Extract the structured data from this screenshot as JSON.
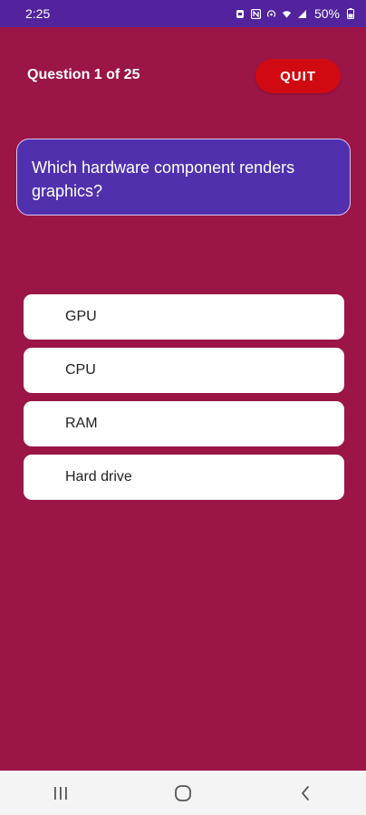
{
  "status_bar": {
    "time": "2:25",
    "battery": "50%",
    "icons": [
      "notification-icon",
      "nfc-icon",
      "hotspot-icon",
      "wifi-icon",
      "signal-icon",
      "battery-icon"
    ]
  },
  "quiz": {
    "counter": "Question 1 of 25",
    "quit_label": "QUIT",
    "question": "Which hardware component renders graphics?",
    "options": [
      "GPU",
      "CPU",
      "RAM",
      "Hard drive"
    ]
  },
  "nav_bar": {
    "icons": [
      "recent-apps-icon",
      "home-icon",
      "back-icon"
    ]
  },
  "colors": {
    "background": "#9b1547",
    "status_bar": "#52239c",
    "question_card": "#5130ad",
    "quit_button": "#d10a12",
    "option_background": "#ffffff",
    "nav_bar": "#f4f4f4"
  }
}
